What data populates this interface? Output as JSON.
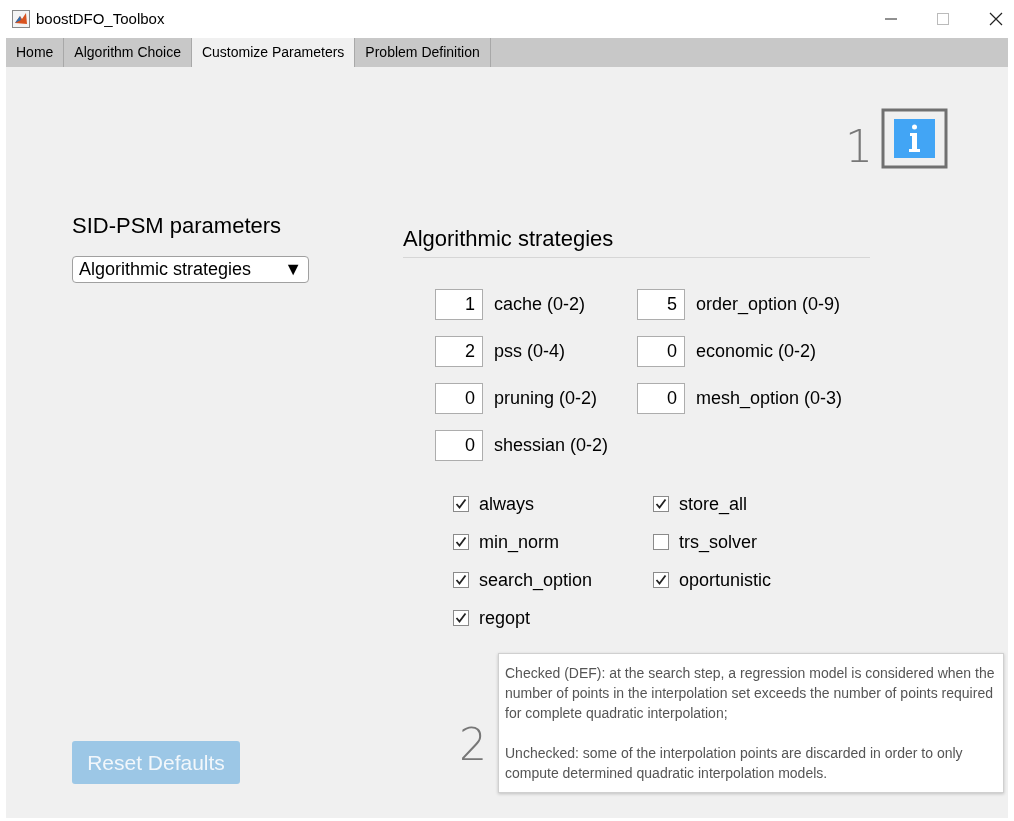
{
  "window": {
    "title": "boostDFO_Toolbox"
  },
  "tabs": [
    {
      "label": "Home",
      "selected": false
    },
    {
      "label": "Algorithm Choice",
      "selected": false
    },
    {
      "label": "Customize Parameters",
      "selected": true
    },
    {
      "label": "Problem Definition",
      "selected": false
    }
  ],
  "left_panel": {
    "heading": "SID-PSM parameters",
    "dropdown": {
      "value": "Algorithmic strategies",
      "arrow": "▼"
    },
    "reset_button": {
      "label": "Reset Defaults",
      "disabled": true
    }
  },
  "annotations": [
    "1",
    "2"
  ],
  "section": {
    "heading": "Algorithmic strategies",
    "fields": [
      {
        "value": "1",
        "label": "cache (0-2)"
      },
      {
        "value": "5",
        "label": "order_option (0-9)"
      },
      {
        "value": "2",
        "label": "pss (0-4)"
      },
      {
        "value": "0",
        "label": "economic (0-2)"
      },
      {
        "value": "0",
        "label": "pruning (0-2)"
      },
      {
        "value": "0",
        "label": "mesh_option (0-3)"
      },
      {
        "value": "0",
        "label": "shessian (0-2)"
      }
    ],
    "checkboxes": [
      {
        "label": "always",
        "checked": true
      },
      {
        "label": "store_all",
        "checked": true
      },
      {
        "label": "min_norm",
        "checked": true
      },
      {
        "label": "trs_solver",
        "checked": false
      },
      {
        "label": "search_option",
        "checked": true
      },
      {
        "label": "oportunistic",
        "checked": true
      },
      {
        "label": "regopt",
        "checked": true
      }
    ]
  },
  "tooltip": {
    "paragraphs": [
      "Checked (DEF): at the search step, a regression model is considered when the number of points in the interpolation set exceeds the number of points required for complete quadratic interpolation;",
      "Unchecked: some of the interpolation points are discarded in order to only compute determined quadratic interpolation models."
    ]
  }
}
